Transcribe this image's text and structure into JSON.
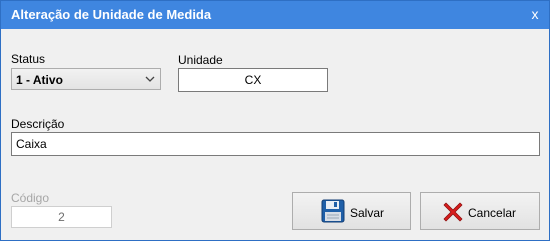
{
  "window": {
    "title": "Alteração de Unidade de Medida",
    "close_label": "x"
  },
  "status": {
    "label": "Status",
    "selected": "1 - Ativo"
  },
  "unidade": {
    "label": "Unidade",
    "value": "CX"
  },
  "descricao": {
    "label": "Descrição",
    "value": "Caixa"
  },
  "codigo": {
    "label": "Código",
    "value": "2"
  },
  "buttons": {
    "save_label": "Salvar",
    "cancel_label": "Cancelar"
  },
  "colors": {
    "titlebar": "#3f86e0",
    "save_icon": "#1f5fa8",
    "cancel_icon": "#d81e1e"
  },
  "icons": {
    "save": "floppy-disk-icon",
    "cancel": "red-x-icon",
    "dropdown": "chevron-down-icon"
  }
}
